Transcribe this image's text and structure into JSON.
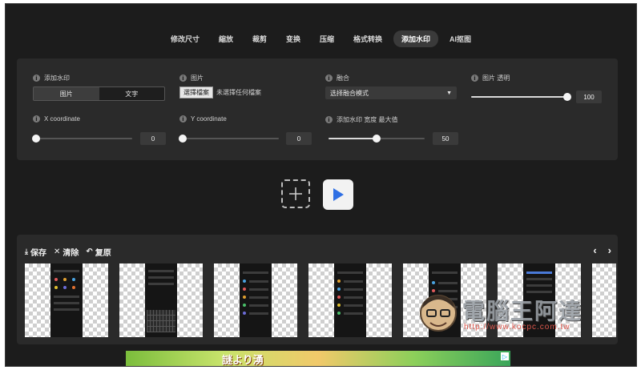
{
  "tabs": [
    {
      "label": "修改尺寸"
    },
    {
      "label": "縮放"
    },
    {
      "label": "裁剪"
    },
    {
      "label": "变换"
    },
    {
      "label": "压缩"
    },
    {
      "label": "格式转换"
    },
    {
      "label": "添加水印",
      "active": true
    },
    {
      "label": "AI抠图"
    }
  ],
  "settings": {
    "watermark": {
      "label": "添加水印",
      "options": [
        "图片",
        "文字"
      ],
      "selected": "图片"
    },
    "image": {
      "label": "图片",
      "file_button": "選擇檔案",
      "file_status": "未選擇任何檔案"
    },
    "blend": {
      "label": "融合",
      "select_value": "选择融合模式"
    },
    "opacity": {
      "label": "图片 透明",
      "value": "100",
      "level": 1.0
    },
    "x_coord": {
      "label": "X coordinate",
      "value": "0",
      "level": 0.0
    },
    "y_coord": {
      "label": "Y coordinate",
      "value": "0",
      "level": 0.0
    },
    "max_width": {
      "label": "添加水印 宽度 最大值",
      "value": "50",
      "level": 0.5
    }
  },
  "actions": {
    "add_icon": "plus-icon",
    "run_icon": "play-icon"
  },
  "gallery": {
    "save_label": "保存",
    "clear_label": "清除",
    "restore_label": "复原",
    "prev_label": "‹",
    "next_label": "›"
  },
  "watermark_logo": {
    "title": "電腦王阿達",
    "url": "http://www.kocpc.com.tw"
  },
  "ad": {
    "text": "謎より湧"
  },
  "colors": {
    "background": "#1c1c1c",
    "panel": "#2a2a2a",
    "accent_play": "#2f6fe4"
  }
}
